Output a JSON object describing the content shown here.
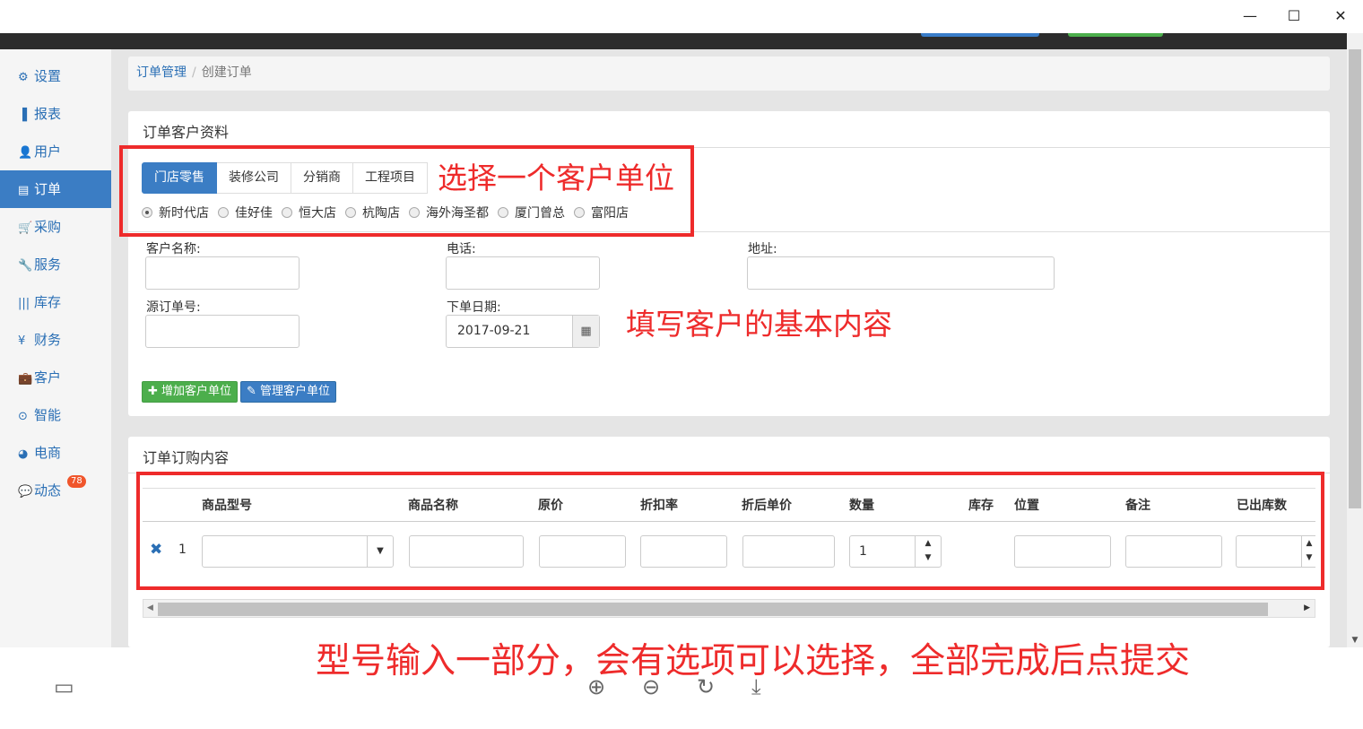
{
  "window": {
    "minimize": "—",
    "maximize": "☐",
    "close": "✕"
  },
  "sidebar": {
    "items": [
      {
        "icon": "⚙",
        "label": "设置"
      },
      {
        "icon": "▐",
        "label": "报表"
      },
      {
        "icon": "👤",
        "label": "用户"
      },
      {
        "icon": "▤",
        "label": "订单"
      },
      {
        "icon": "🛒",
        "label": "采购"
      },
      {
        "icon": "🔧",
        "label": "服务"
      },
      {
        "icon": "|||",
        "label": "库存"
      },
      {
        "icon": "¥",
        "label": "财务"
      },
      {
        "icon": "💼",
        "label": "客户"
      },
      {
        "icon": "⊙",
        "label": "智能"
      },
      {
        "icon": "◕",
        "label": "电商"
      },
      {
        "icon": "💬",
        "label": "动态"
      }
    ],
    "active_index": 3,
    "badge": "78"
  },
  "breadcrumb": {
    "parent": "订单管理",
    "separator": "/",
    "current": "创建订单"
  },
  "customer_panel": {
    "title": "订单客户资料",
    "tabs": [
      "门店零售",
      "装修公司",
      "分销商",
      "工程项目"
    ],
    "active_tab": 0,
    "radios": [
      "新时代店",
      "佳好佳",
      "恒大店",
      "杭陶店",
      "海外海圣都",
      "厦门曾总",
      "富阳店"
    ],
    "selected_radio": 0,
    "fields": {
      "customer_name_label": "客户名称:",
      "phone_label": "电话:",
      "address_label": "地址:",
      "source_order_label": "源订单号:",
      "order_date_label": "下单日期:",
      "order_date_value": "2017-09-21"
    },
    "add_button": "增加客户单位",
    "manage_button": "管理客户单位"
  },
  "items_panel": {
    "title": "订单订购内容",
    "columns": [
      "商品型号",
      "商品名称",
      "原价",
      "折扣率",
      "折后单价",
      "数量",
      "库存",
      "位置",
      "备注",
      "已出库数"
    ],
    "rows": [
      {
        "index": "1",
        "quantity": "1"
      }
    ]
  },
  "annotations": {
    "select_unit": "选择一个客户单位",
    "fill_info": "填写客户的基本内容",
    "submit_hint": "型号输入一部分，会有选项可以选择，全部完成后点提交"
  },
  "colors": {
    "accent": "#3b7dc4",
    "annotation_red": "#ee2b2b",
    "green": "#4cae4c"
  }
}
